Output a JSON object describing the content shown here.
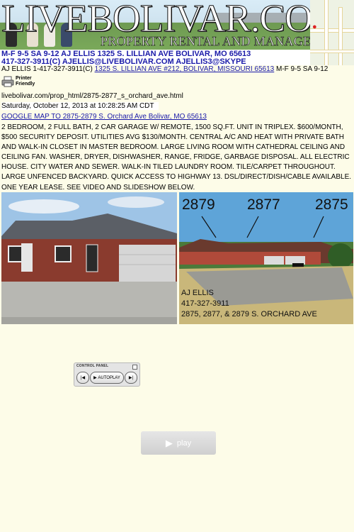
{
  "banner": {
    "site_title": "LIVEBOLIVAR.COM",
    "subtitle": "PROPERTY RENTAL AND MANAGEMENT",
    "line1": "M-F 9-5  SA 9-12  AJ ELLIS 1325 S. LILLIAN AVE BOLIVAR, MO 65613",
    "line2": "417-327-3911(C)  AJELLIS@LIVEBOLIVAR.COM  AJELLIS3@SKYPE"
  },
  "contact": {
    "prefix": "AJ ELLIS  1-417-327-3911(C) ",
    "address_link": "1325 S. LILLIAN AVE #212, BOLIVAR, MISSOURI 65613",
    "hours": " M-F 9-5 SA 9-12"
  },
  "printer": {
    "label_line1": "Printer",
    "label_line2": "Friendly"
  },
  "page_url": "livebolivar.com/prop_html/2875-2877_s_orchard_ave.html",
  "timestamp": "Saturday, October 12, 2013 at 10:28:25 AM CDT",
  "map_link": "GOOGLE MAP TO 2875-2879 S. Orchard Ave Bolivar, MO 65613",
  "description": "2 BEDROOM, 2 FULL BATH, 2 CAR GARAGE W/ REMOTE, 1500 SQ.FT. UNIT IN TRIPLEX.  $600/MONTH, $500 SECURITY DEPOSIT.  UTILITIES AVG $130/MONTH.   CENTRAL A/C AND HEAT WITH PRIVATE BATH AND WALK-IN CLOSET IN MASTER BEDROOM.   LARGE LIVING ROOM WITH CATHEDRAL CEILING AND CEILING FAN.   WASHER, DRYER, DISHWASHER, RANGE, FRIDGE, GARBAGE DISPOSAL.  ALL ELECTRIC HOUSE.  CITY WATER AND SEWER.  WALK-IN TILED LAUNDRY ROOM.  TILE/CARPET THROUGHOUT.  LARGE UNFENCED BACKYARD.   QUICK ACCESS TO HIGHWAY 13.  DSL/DIRECT/DISH/CABLE AVAILABLE.  ONE YEAR LEASE.   SEE VIDEO AND SLIDESHOW BELOW.",
  "photo_right": {
    "unit_a": "2879",
    "unit_b": "2877",
    "unit_c": "2875",
    "sign_line1": "AJ ELLIS",
    "sign_line2": "417-327-3911",
    "sign_line3": "2875, 2877, & 2879 S. ORCHARD AVE"
  },
  "control_panel": {
    "title": "CONTROL PANEL",
    "autoplay_label": "AUTOPLAY"
  },
  "video": {
    "play_label": "play"
  },
  "colors": {
    "link": "#1a1aa8",
    "page_bg": "#fdfce8"
  }
}
